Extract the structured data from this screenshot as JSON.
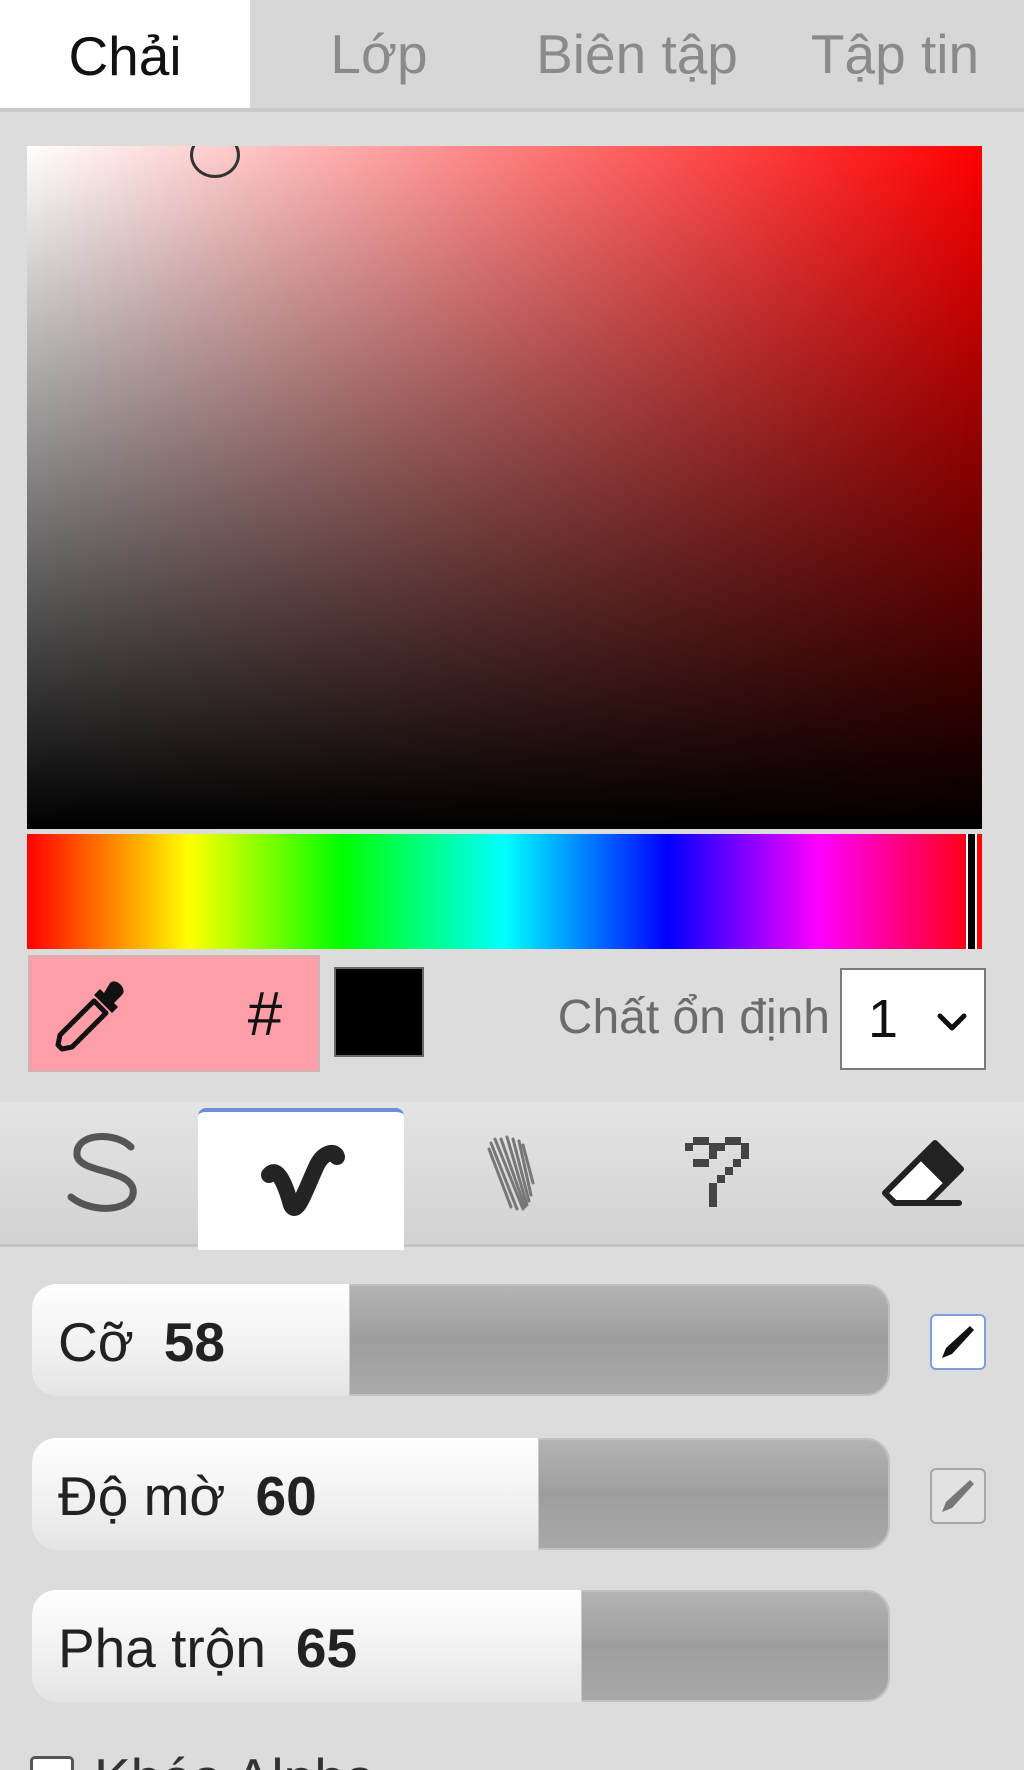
{
  "tabs": [
    {
      "label": "Chải",
      "active": true
    },
    {
      "label": "Lớp",
      "active": false
    },
    {
      "label": "Biên tập",
      "active": false
    },
    {
      "label": "Tập tin",
      "active": false
    }
  ],
  "color": {
    "hue_color": "#ff0000",
    "primary_color": "#ff9ea8",
    "secondary_color": "#000000",
    "hash_label": "#"
  },
  "stabilizer": {
    "label": "Chất ổn định",
    "value": "1"
  },
  "brush_tabs": [
    {
      "icon": "pen-stroke-icon",
      "active": false
    },
    {
      "icon": "blend-brush-icon",
      "active": true
    },
    {
      "icon": "sketch-brush-icon",
      "active": false
    },
    {
      "icon": "pixel-brush-icon",
      "active": false
    },
    {
      "icon": "eraser-icon",
      "active": false
    }
  ],
  "sliders": {
    "size": {
      "label": "Cỡ",
      "value": "58",
      "fill_fraction": 0.37
    },
    "opacity": {
      "label": "Độ mờ",
      "value": "60",
      "fill_fraction": 0.59
    },
    "blend": {
      "label": "Pha trộn",
      "value": "65",
      "fill_fraction": 0.64
    }
  },
  "pressure": {
    "size_enabled": true,
    "opacity_enabled": false
  },
  "lock_alpha": {
    "label": "Khóa Alpha",
    "checked": false
  }
}
